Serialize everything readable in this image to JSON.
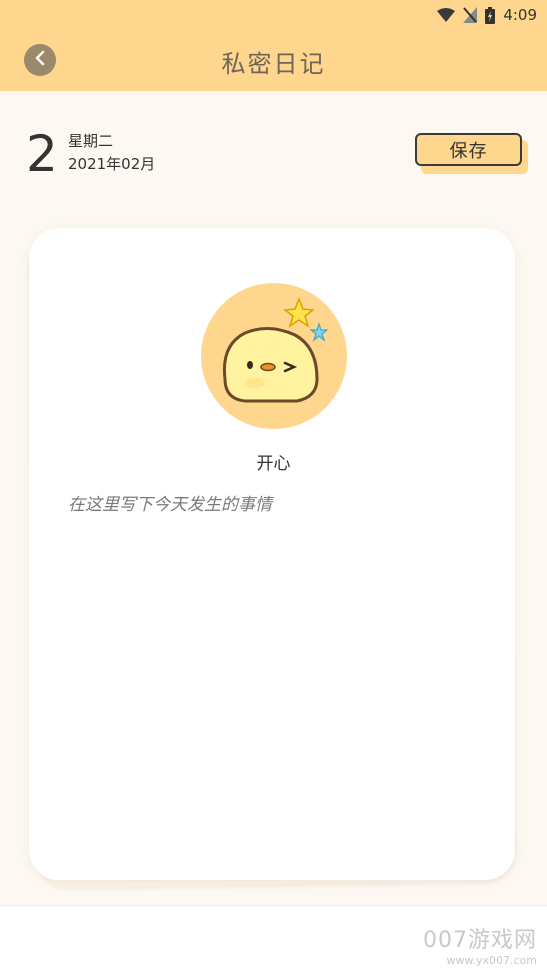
{
  "status_bar": {
    "time": "4:09",
    "icons": [
      "wifi-icon",
      "no-signal-icon",
      "battery-icon"
    ]
  },
  "header": {
    "title": "私密日记",
    "back_icon": "chevron-left-icon"
  },
  "date": {
    "day": "2",
    "weekday": "星期二",
    "year_month": "2021年02月"
  },
  "toolbar": {
    "save_label": "保存"
  },
  "mood": {
    "icon": "chick-mood-icon",
    "label": "开心"
  },
  "entry": {
    "placeholder": "在这里写下今天发生的事情",
    "value": ""
  },
  "watermark": {
    "text": "007游戏网",
    "url": "www.yx007.com"
  },
  "colors": {
    "accent": "#ffd68d",
    "back_button": "#9a8a6b",
    "background": "#fdf8f2"
  }
}
